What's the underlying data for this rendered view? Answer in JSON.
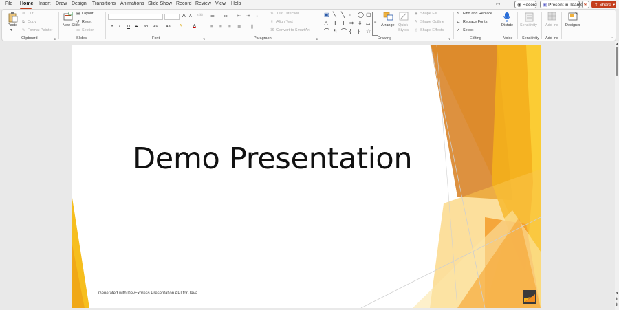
{
  "menu": {
    "tabs": [
      "File",
      "Home",
      "Insert",
      "Draw",
      "Design",
      "Transitions",
      "Animations",
      "Slide Show",
      "Record",
      "Review",
      "View",
      "Help"
    ],
    "active_tab": "Home"
  },
  "top_buttons": {
    "record": "Record",
    "present_in_teams": "Present in Teams",
    "share": "Share"
  },
  "ribbon": {
    "clipboard": {
      "label": "Clipboard",
      "paste": "Paste",
      "cut": "Cut",
      "copy": "Copy",
      "format_painter": "Format Painter"
    },
    "slides": {
      "label": "Slides",
      "new_slide": "New Slide",
      "layout": "Layout",
      "reset": "Reset",
      "section": "Section"
    },
    "font": {
      "label": "Font",
      "bold": "B",
      "italic": "I",
      "underline": "U",
      "strike": "S",
      "shadow": "ab",
      "spacing": "AV",
      "case": "Aa",
      "grow": "A",
      "shrink": "A"
    },
    "paragraph": {
      "label": "Paragraph",
      "text_direction": "Text Direction",
      "align_text": "Align Text",
      "convert_smartart": "Convert to SmartArt"
    },
    "drawing": {
      "label": "Drawing",
      "arrange": "Arrange",
      "quick_styles": "Quick Styles",
      "shape_fill": "Shape Fill",
      "shape_outline": "Shape Outline",
      "shape_effects": "Shape Effects"
    },
    "editing": {
      "label": "Editing",
      "find_replace": "Find and Replace",
      "replace_fonts": "Replace Fonts",
      "select": "Select"
    },
    "voice": {
      "label": "Voice",
      "dictate": "Dictate"
    },
    "sensitivity": {
      "label": "Sensitivity",
      "sensitivity": "Sensitivity"
    },
    "addins": {
      "label": "Add-ins",
      "addins": "Add-ins"
    },
    "designer": {
      "label": "",
      "designer": "Designer"
    }
  },
  "slide": {
    "title": "Demo Presentation",
    "footer": "Generated with DevExpress Presentation API for Java"
  }
}
